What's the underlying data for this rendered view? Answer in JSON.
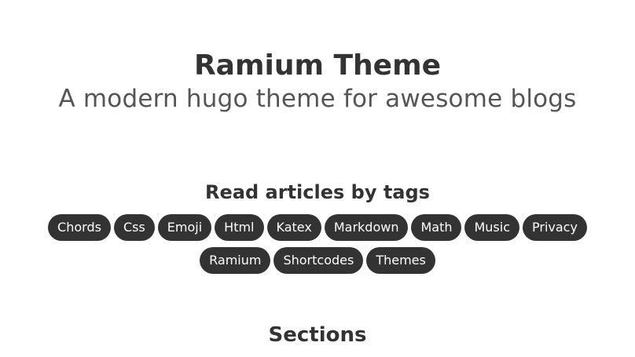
{
  "site": {
    "title": "Ramium Theme",
    "subtitle": "A modern hugo theme for awesome blogs"
  },
  "tags_section": {
    "heading": "Read articles by tags",
    "tags": [
      "Chords",
      "Css",
      "Emoji",
      "Html",
      "Katex",
      "Markdown",
      "Math",
      "Music",
      "Privacy",
      "Ramium",
      "Shortcodes",
      "Themes"
    ]
  },
  "sections": {
    "heading": "Sections"
  },
  "colors": {
    "text": "#333333",
    "subtitle": "#555555",
    "tag_background": "#333333",
    "tag_text": "#ffffff",
    "page_background": "#ffffff"
  }
}
